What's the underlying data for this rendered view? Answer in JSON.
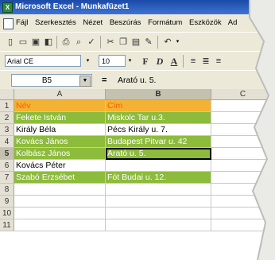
{
  "window": {
    "title": "Microsoft Excel - Munkafüzet1",
    "app_icon": "excel-icon"
  },
  "menu": [
    "Fájl",
    "Szerkesztés",
    "Nézet",
    "Beszúrás",
    "Formátum",
    "Eszközök",
    "Ad"
  ],
  "format_toolbar": {
    "font": "Arial CE",
    "size": "10",
    "bold": "F",
    "italic": "D",
    "underline": "A"
  },
  "formula_bar": {
    "cell_ref": "B5",
    "equals": "=",
    "value": "Arató u. 5."
  },
  "columns": [
    "A",
    "B",
    "C"
  ],
  "rows": [
    {
      "num": "1",
      "a": "Név",
      "b": "Cím",
      "style": "orange"
    },
    {
      "num": "2",
      "a": "Fekete István",
      "b": "Miskolc Tar u.3.",
      "style": "green"
    },
    {
      "num": "3",
      "a": "Király Béla",
      "b": "Pécs Király u. 7.",
      "style": "plain"
    },
    {
      "num": "4",
      "a": "Kovács János",
      "b": "Budapest Pitvar u. 42",
      "style": "green"
    },
    {
      "num": "5",
      "a": "Kolbász János",
      "b": "Arató u. 5.",
      "style": "green"
    },
    {
      "num": "6",
      "a": "Kovács Péter",
      "b": "",
      "style": "plain"
    },
    {
      "num": "7",
      "a": "Szabó Erzsébet",
      "b": "Fót Budai u. 12.",
      "style": "green"
    },
    {
      "num": "8",
      "a": "",
      "b": "",
      "style": "plain"
    },
    {
      "num": "9",
      "a": "",
      "b": "",
      "style": "plain"
    },
    {
      "num": "10",
      "a": "",
      "b": "",
      "style": "plain"
    },
    {
      "num": "11",
      "a": "",
      "b": "",
      "style": "plain"
    }
  ],
  "active_cell": "B5",
  "colors": {
    "green": "#8dbb3c",
    "orange": "#f3b233",
    "header_text": "#ff5a00",
    "title_bar": "#1b4aa8"
  }
}
